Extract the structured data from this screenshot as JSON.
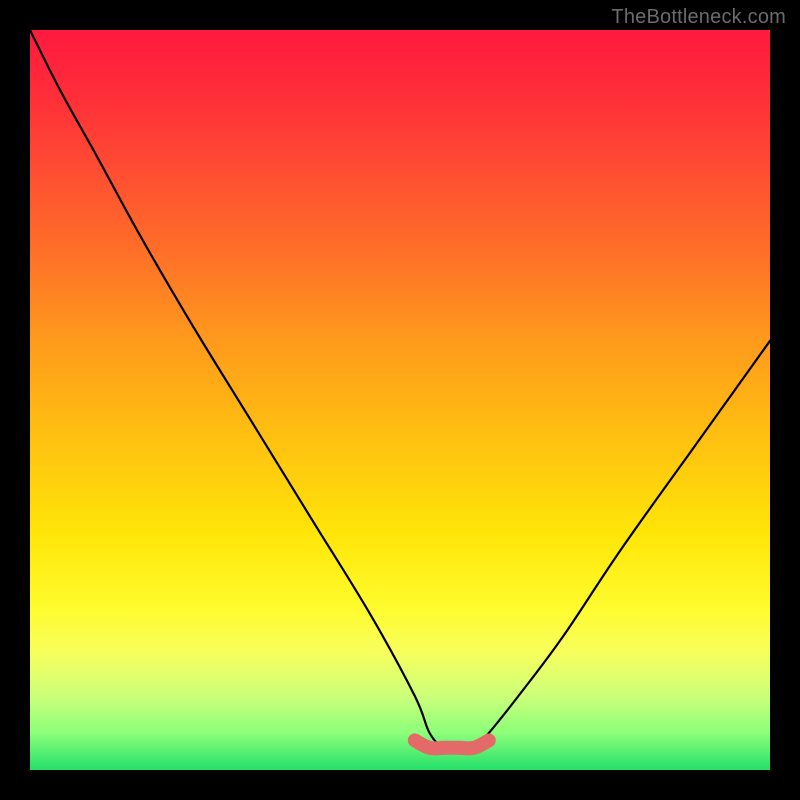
{
  "watermark": "TheBottleneck.com",
  "chart_data": {
    "type": "line",
    "title": "",
    "xlabel": "",
    "ylabel": "",
    "xlim": [
      0,
      100
    ],
    "ylim": [
      0,
      100
    ],
    "series": [
      {
        "name": "bottleneck-curve",
        "x": [
          0,
          4,
          9,
          15,
          22,
          30,
          38,
          46,
          52,
          54,
          56,
          58,
          60,
          62,
          66,
          72,
          80,
          90,
          100
        ],
        "values": [
          100,
          92,
          83,
          72,
          60,
          47,
          34,
          21,
          10,
          5,
          3,
          3,
          3,
          5,
          10,
          18,
          30,
          44,
          58
        ]
      },
      {
        "name": "highlight-zone",
        "x": [
          52,
          54,
          56,
          58,
          60,
          62
        ],
        "values": [
          4,
          3,
          3,
          3,
          3,
          4
        ]
      }
    ],
    "background_gradient": {
      "top": "#ff1a3f",
      "mid": "#ffe508",
      "bottom": "#24e06a"
    }
  }
}
